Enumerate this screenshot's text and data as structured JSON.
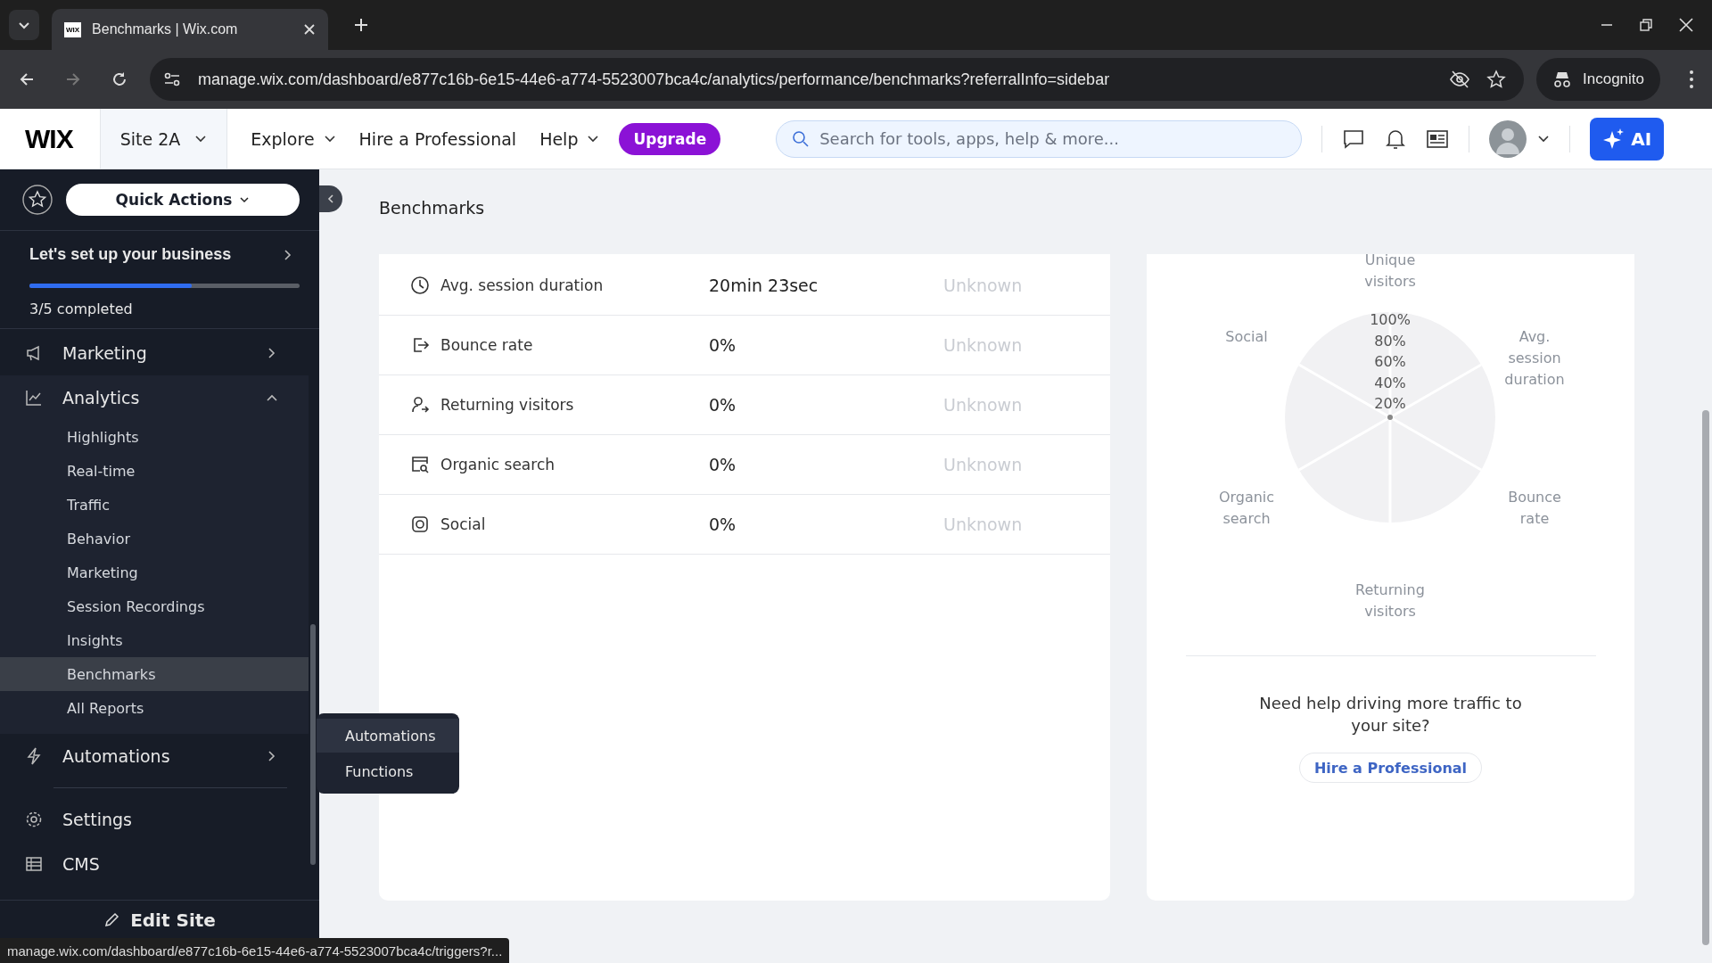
{
  "browser": {
    "tab_title": "Benchmarks | Wix.com",
    "favicon": "WIX",
    "url": "manage.wix.com/dashboard/e877c16b-6e15-44e6-a774-5523007bca4c/analytics/performance/benchmarks?referralInfo=sidebar",
    "profile": "Incognito"
  },
  "header": {
    "logo": "WIX",
    "site": "Site 2A",
    "nav": [
      "Explore",
      "Hire a Professional",
      "Help"
    ],
    "upgrade": "Upgrade",
    "search": {
      "placeholder": "Search for tools, apps, help & more..."
    },
    "ai": "AI"
  },
  "sidebar": {
    "quick_actions": "Quick Actions",
    "setup": {
      "title": "Let's set up your business",
      "progress": "3/5 completed",
      "level": 0.6
    },
    "groups": [
      {
        "label": "Marketing",
        "expanded": false
      },
      {
        "label": "Analytics",
        "expanded": true,
        "children": [
          {
            "label": "Highlights",
            "selected": false
          },
          {
            "label": "Real-time",
            "selected": false
          },
          {
            "label": "Traffic",
            "selected": false
          },
          {
            "label": "Behavior",
            "selected": false
          },
          {
            "label": "Marketing",
            "selected": false
          },
          {
            "label": "Session Recordings",
            "selected": false
          },
          {
            "label": "Insights",
            "selected": false
          },
          {
            "label": "Benchmarks",
            "selected": true
          },
          {
            "label": "All Reports",
            "selected": false
          }
        ]
      },
      {
        "label": "Automations",
        "expanded": false
      }
    ],
    "items": [
      "Settings",
      "CMS"
    ],
    "edit_site": "Edit Site"
  },
  "page_title": "Benchmarks",
  "metrics": [
    {
      "label": "Avg. session duration",
      "value": "20min 23sec",
      "benchmark": "Unknown"
    },
    {
      "label": "Bounce rate",
      "value": "0%",
      "benchmark": "Unknown"
    },
    {
      "label": "Returning visitors",
      "value": "0%",
      "benchmark": "Unknown"
    },
    {
      "label": "Organic search",
      "value": "0%",
      "benchmark": "Unknown"
    },
    {
      "label": "Social",
      "value": "0%",
      "benchmark": "Unknown"
    }
  ],
  "radar": {
    "ticks": [
      "100%",
      "80%",
      "60%",
      "40%",
      "20%"
    ],
    "axes": [
      "Unique visitors",
      "Social",
      "Avg. session duration",
      "Organic search",
      "Bounce rate",
      "Returning visitors"
    ]
  },
  "help": {
    "text": "Need help driving more traffic to your site?",
    "button": "Hire a Professional"
  },
  "flyout": [
    {
      "label": "Automations",
      "selected": true
    },
    {
      "label": "Functions",
      "selected": false
    }
  ],
  "status_url": "manage.wix.com/dashboard/e877c16b-6e15-44e6-a774-5523007bca4c/triggers?r..."
}
